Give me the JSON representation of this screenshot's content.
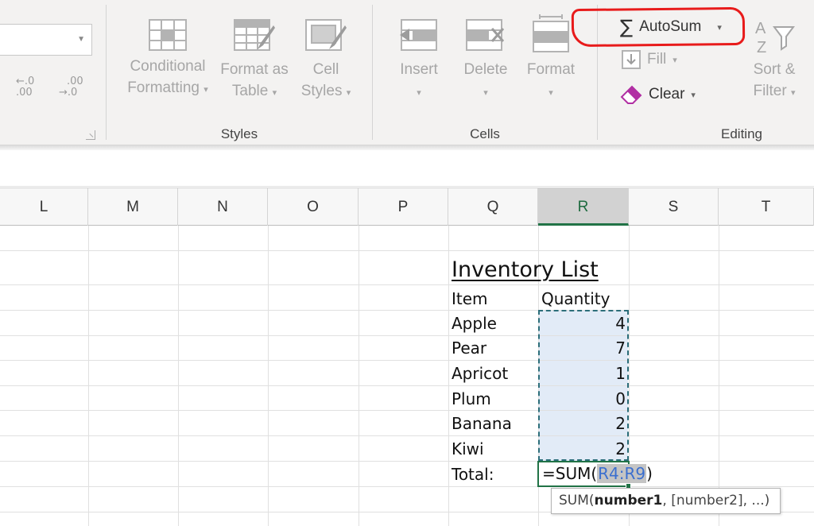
{
  "ribbon": {
    "number_group": {
      "increase_decimal": {
        "arrow": "←",
        "top": ".0",
        "bottom": ".00"
      },
      "decrease_decimal": {
        "arrow": "→",
        "top": ".00",
        "bottom": ".0"
      }
    },
    "styles_group": {
      "label": "Styles",
      "conditional_formatting": {
        "line1": "Conditional",
        "line2": "Formatting"
      },
      "format_as_table": {
        "line1": "Format as",
        "line2": "Table"
      },
      "cell_styles": {
        "line1": "Cell",
        "line2": "Styles"
      }
    },
    "cells_group": {
      "label": "Cells",
      "insert": "Insert",
      "delete": "Delete",
      "format": "Format"
    },
    "editing_group": {
      "label": "Editing",
      "autosum": {
        "symbol": "∑",
        "label": "AutoSum"
      },
      "fill": "Fill",
      "clear": "Clear",
      "sort_filter": {
        "line1": "Sort &",
        "line2": "Filter"
      }
    },
    "dropdown_glyph": "▾"
  },
  "columns": [
    "L",
    "M",
    "N",
    "O",
    "P",
    "Q",
    "R",
    "S",
    "T"
  ],
  "active_column": "R",
  "sheet": {
    "title": "Inventory List",
    "header_item": "Item",
    "header_quantity": "Quantity",
    "rows": [
      {
        "item": "Apple",
        "quantity": "4"
      },
      {
        "item": "Pear",
        "quantity": "7"
      },
      {
        "item": "Apricot",
        "quantity": "1"
      },
      {
        "item": "Plum",
        "quantity": "0"
      },
      {
        "item": "Banana",
        "quantity": "2"
      },
      {
        "item": "Kiwi",
        "quantity": "2"
      }
    ],
    "total_label": "Total:",
    "formula": {
      "prefix": "=SUM(",
      "range": "R4:R9",
      "suffix": ")"
    }
  },
  "tooltip": {
    "func": "SUM(",
    "arg1": "number1",
    "rest": ", [number2], ...)"
  },
  "colors": {
    "accent_green": "#217346",
    "selection_fill": "#e2ebf7",
    "annotation_red": "#e81b1b",
    "reference_blue": "#3b6fcf"
  }
}
